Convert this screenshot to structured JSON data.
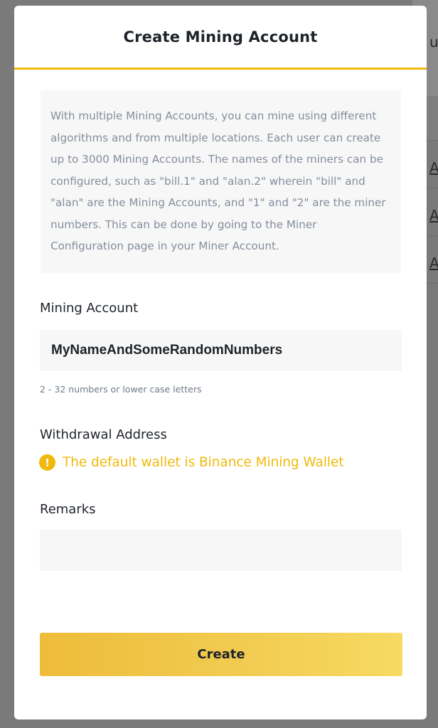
{
  "modal": {
    "title": "Create Mining Account",
    "info_text": "With multiple Mining Accounts, you can mine using different algorithms and from multiple locations. Each user can create up to 3000 Mining Accounts. The names of the miners can be configured, such as \"bill.1\" and \"alan.2\" wherein \"bill\" and \"alan\" are the Mining Accounts, and \"1\" and \"2\" are the miner numbers. This can be done by going to the Miner Configuration page in your Miner Account.",
    "mining_account": {
      "label": "Mining Account",
      "value": "MyNameAndSomeRandomNumbers",
      "hint": "2 - 32 numbers or lower case letters"
    },
    "withdrawal_address": {
      "label": "Withdrawal Address",
      "warning_icon": "exclamation-circle-icon",
      "warning_text": "The default wallet is Binance Mining Wallet"
    },
    "remarks": {
      "label": "Remarks",
      "value": ""
    },
    "create_button_label": "Create"
  },
  "background": {
    "partial_glyphs": [
      "u",
      "A",
      "A",
      "A"
    ]
  },
  "colors": {
    "accent": "#f0b90b",
    "text_primary": "#1e2329",
    "text_secondary": "#848e9c",
    "field_bg": "#f7f7f7"
  }
}
